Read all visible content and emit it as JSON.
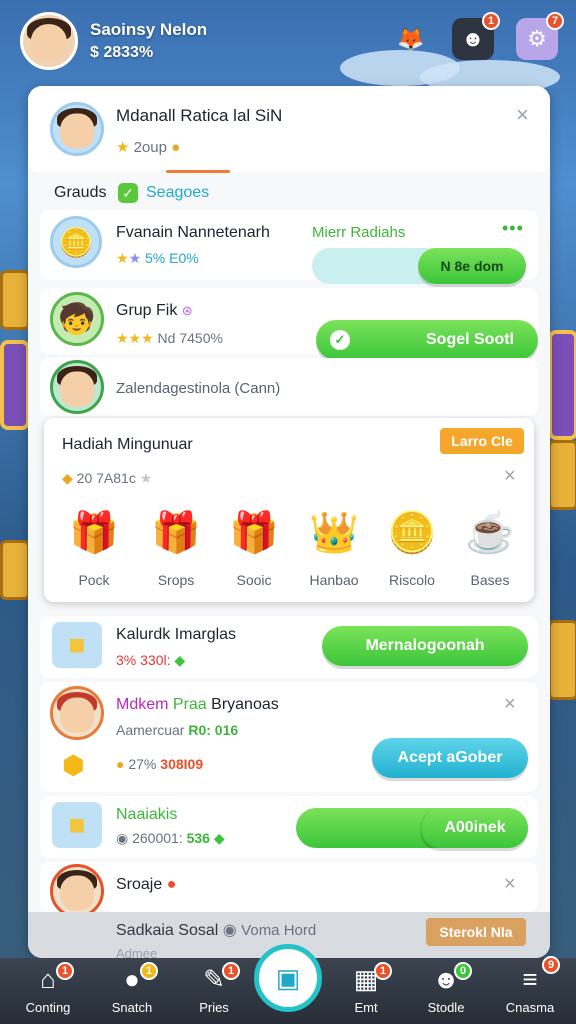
{
  "header": {
    "name": "Saoinsy Nelon",
    "balance": "$ 2833%"
  },
  "panel_top": {
    "title": "Mdanall Ratica lal SiN",
    "sub": "2oup"
  },
  "section": {
    "tab1": "Grauds",
    "tab2": "Seagoes"
  },
  "row1": {
    "name": "Fvanain Nannetenarh",
    "stats": "5% E0%",
    "label": "Mierr Radiahs",
    "button": "N 8e dom"
  },
  "row2": {
    "name": "Grup Fik",
    "stats": "Nd 7450%",
    "button": "Sogel Sootl"
  },
  "row3": {
    "name": "Zalendagestinola (Cann)"
  },
  "gifts": {
    "title": "Hadiah Mingunuar",
    "badge": "Larro Cle",
    "count": "20 7A81c",
    "items": [
      {
        "label": "Pock",
        "icon": "gift-box-icon"
      },
      {
        "label": "Srops",
        "icon": "gift-box-icon"
      },
      {
        "label": "Sooic",
        "icon": "gift-box-icon"
      },
      {
        "label": "Hanbao",
        "icon": "treasure-icon"
      },
      {
        "label": "Riscolo",
        "icon": "gold-pile-icon"
      },
      {
        "label": "Bases",
        "icon": "cup-icon"
      }
    ]
  },
  "row4": {
    "name": "Kalurdk Imarglas",
    "stats": "3% 330l:",
    "button": "Mernalogoonah"
  },
  "row5": {
    "name_a": "Mdkem",
    "name_b": "Praa",
    "name_c": "Bryanoas",
    "sub": "Aamercuar",
    "sub_tag": "R0: 016",
    "stats": "27%",
    "stats_b": "308I09",
    "button": "Acept aGober"
  },
  "row6": {
    "name": "Naaiakis",
    "stats": "260001:",
    "stats_b": "536",
    "button": "A00inek"
  },
  "row7": {
    "name": "Sroaje"
  },
  "row8": {
    "name": "Sadkaia Sosal",
    "sub": "Voma Hord",
    "faint": "Admee",
    "button": "Sterokl Nla"
  },
  "nav": {
    "items": [
      {
        "label": "Conting",
        "badge": "1"
      },
      {
        "label": "Snatch",
        "badge": "1"
      },
      {
        "label": "Pries",
        "badge": "1"
      },
      {
        "label": "Emt",
        "badge": "1"
      },
      {
        "label": "Stodle",
        "badge": "0"
      },
      {
        "label": "Cnasma",
        "badge": "9"
      }
    ]
  },
  "top_badges": {
    "b1": "1",
    "b2": "7"
  }
}
